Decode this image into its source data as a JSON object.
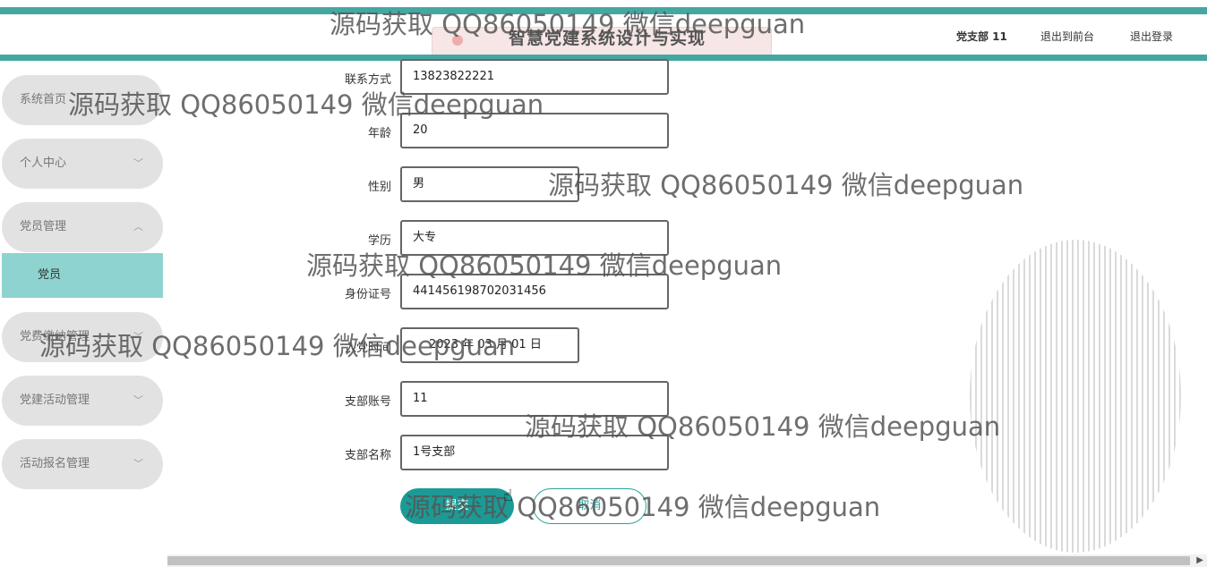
{
  "header": {
    "app_title": "智慧党建系统设计与实现",
    "user_label": "党支部 11",
    "front_link": "退出到前台",
    "logout_link": "退出登录"
  },
  "sidebar": {
    "items": [
      {
        "label": "系统首页",
        "chevron": ""
      },
      {
        "label": "个人中心",
        "chevron": "﹀"
      },
      {
        "label": "党员管理",
        "chevron": "︿"
      },
      {
        "label": "党费缴纳管理",
        "chevron": "﹀"
      },
      {
        "label": "党建活动管理",
        "chevron": "﹀"
      },
      {
        "label": "活动报名管理",
        "chevron": "﹀"
      }
    ],
    "active_sub": "党员"
  },
  "form": {
    "fields": [
      {
        "label": "联系方式",
        "value": "13823822221"
      },
      {
        "label": "年龄",
        "value": "20"
      },
      {
        "label": "性别",
        "value": "男"
      },
      {
        "label": "学历",
        "value": "大专"
      },
      {
        "label": "身份证号",
        "value": "441456198702031456"
      },
      {
        "label": "入党时间",
        "value": "2023 年 03 月 01 日"
      },
      {
        "label": "支部账号",
        "value": "11"
      },
      {
        "label": "支部名称",
        "value": "1号支部"
      }
    ],
    "submit_label": "提交",
    "cancel_label": "取消"
  },
  "watermark": "源码获取 QQ86050149 微信deepguan",
  "colors": {
    "accent": "#44a7a2",
    "submenu_active": "#8ed3cf",
    "submit_button": "#1c9a95"
  }
}
